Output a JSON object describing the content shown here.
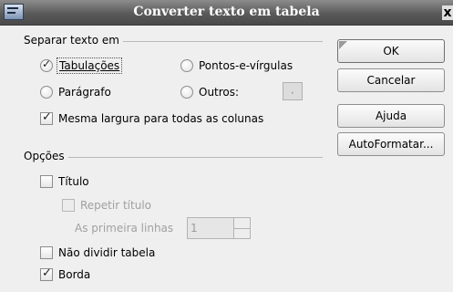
{
  "window": {
    "title": "Converter texto em tabela",
    "close_glyph": "x"
  },
  "separator_section": {
    "header": "Separar texto em",
    "options": [
      {
        "label": "Tabulações",
        "type": "radio",
        "checked": true
      },
      {
        "label": "Pontos-e-vírgulas",
        "type": "radio",
        "checked": false
      },
      {
        "label": "Parágrafo",
        "type": "radio",
        "checked": false
      },
      {
        "label": "Outros:",
        "type": "radio",
        "checked": false
      }
    ],
    "other_char_value": ",",
    "equal_width": {
      "label": "Mesma largura para todas as colunas",
      "checked": true
    }
  },
  "options_section": {
    "header": "Opções",
    "title": {
      "label": "Título",
      "checked": false
    },
    "repeat_title": {
      "label": "Repetir título",
      "checked": false,
      "enabled": false
    },
    "first_rows": {
      "label": "As primeira linhas",
      "value": "1",
      "enabled": false
    },
    "dont_split": {
      "label": "Não dividir tabela",
      "checked": false
    },
    "border": {
      "label": "Borda",
      "checked": true
    }
  },
  "buttons": {
    "ok": "OK",
    "cancel": "Cancelar",
    "help": "Ajuda",
    "autoformat": "AutoFormatar..."
  },
  "colors": {
    "titlebar_top": "#8c8c8c",
    "titlebar_bottom": "#4a4a4a",
    "dialog_bg": "#efefef",
    "disabled_text": "#a0a0a0"
  }
}
